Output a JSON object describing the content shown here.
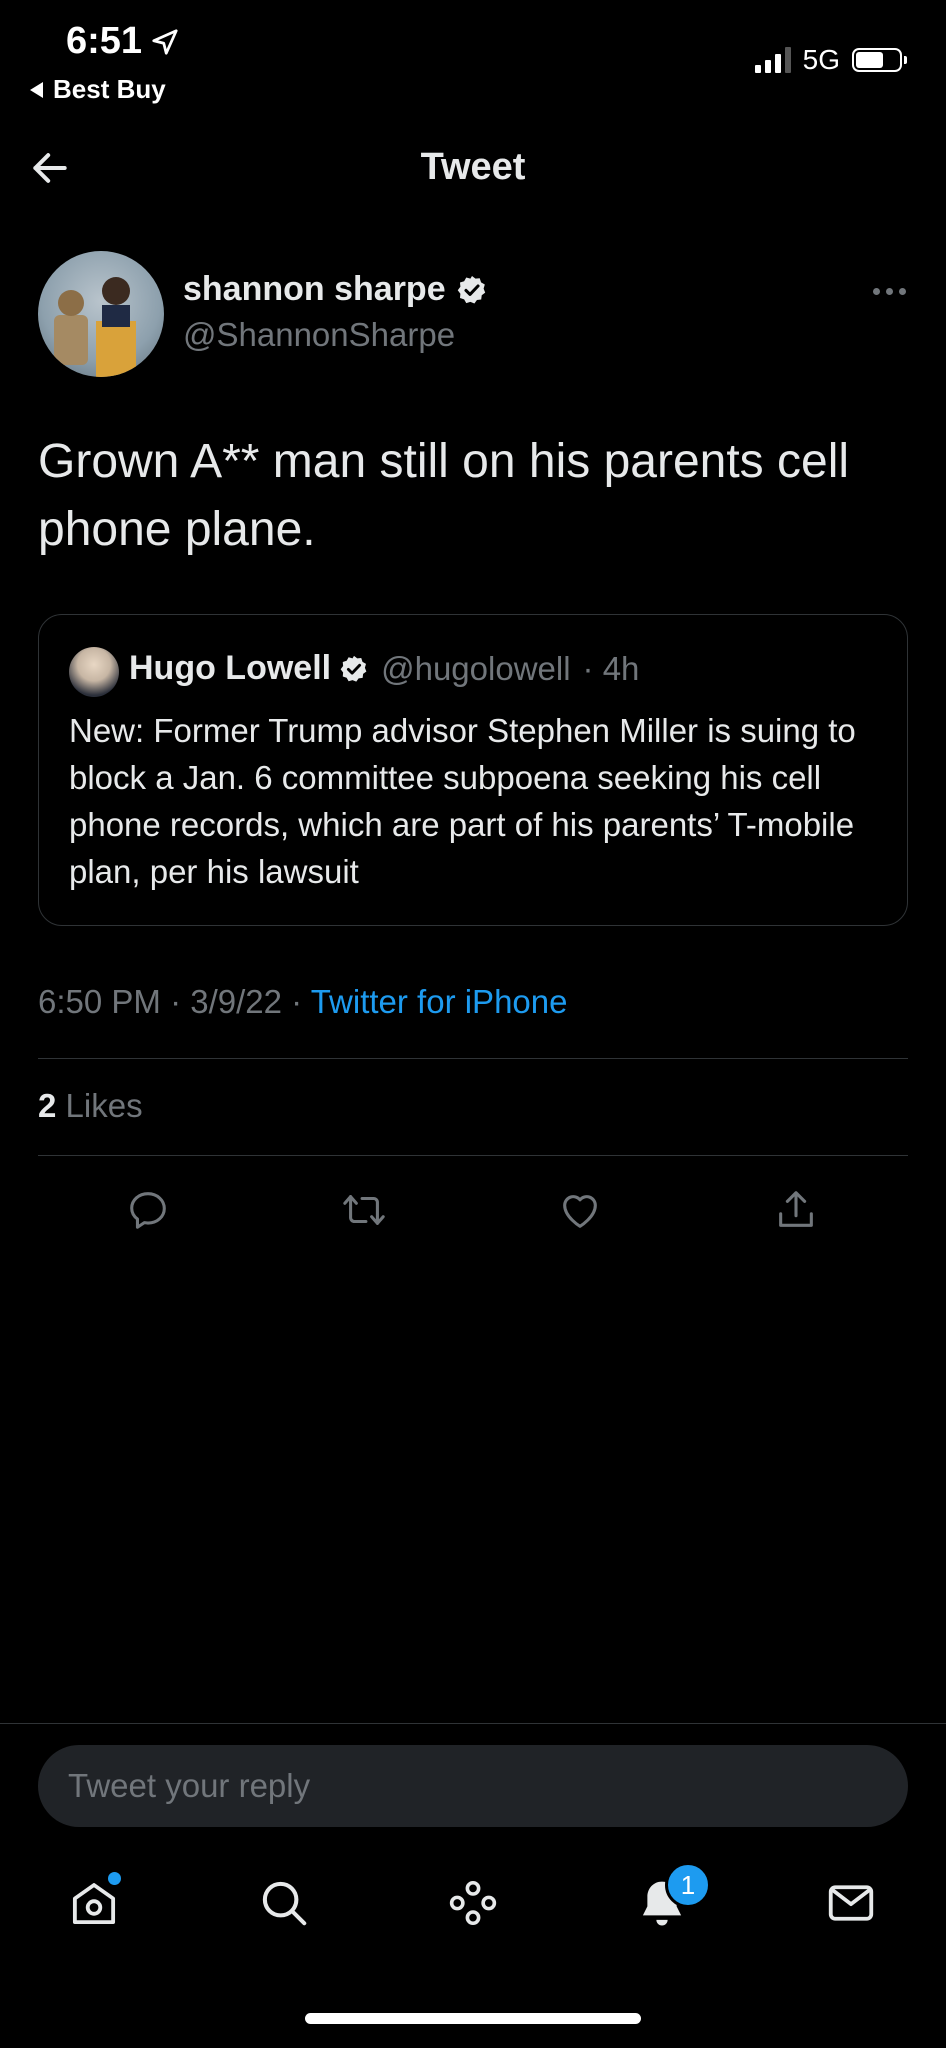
{
  "status_bar": {
    "time": "6:51",
    "back_app": "Best Buy",
    "network": "5G",
    "battery_level": 0.65
  },
  "nav": {
    "title": "Tweet"
  },
  "tweet": {
    "author_name": "shannon sharpe",
    "author_handle": "@ShannonSharpe",
    "text": "Grown A** man still on his parents cell phone plane.",
    "quoted": {
      "name": "Hugo Lowell",
      "handle": "@hugolowell",
      "time": "· 4h",
      "text": "New: Former Trump advisor Stephen Miller is suing to block a Jan. 6 committee subpoena seeking his cell phone records, which are part of his parents’ T-mobile plan, per his lawsuit"
    },
    "timestamp": "6:50 PM · 3/9/22 · ",
    "source": "Twitter for iPhone",
    "likes_count": "2",
    "likes_label": "Likes"
  },
  "reply": {
    "placeholder": "Tweet your reply"
  },
  "tabbar": {
    "notification_count": "1"
  },
  "colors": {
    "accent": "#1d9bf0",
    "background": "#000000",
    "secondary_text": "#71767b"
  }
}
